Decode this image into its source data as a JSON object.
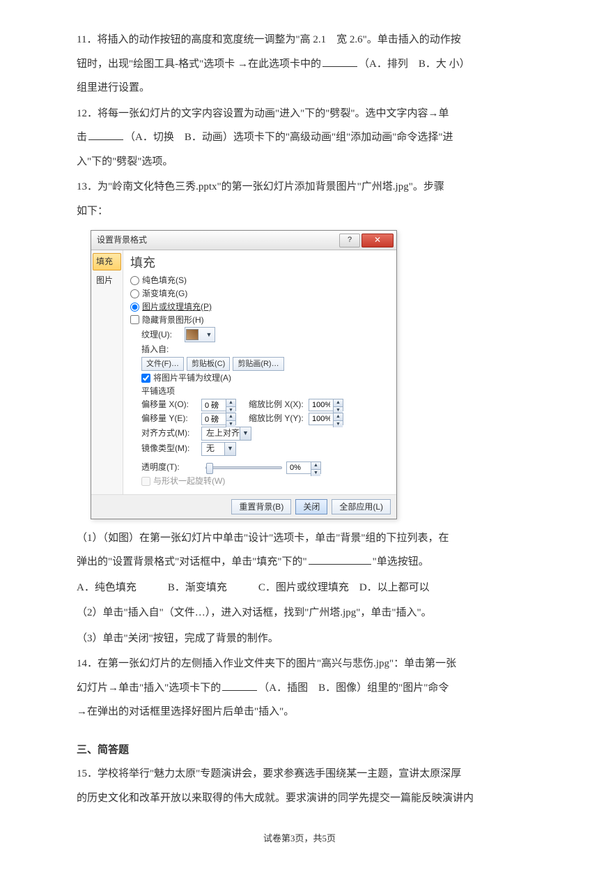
{
  "q11": {
    "text_a": "11．将插入的动作按钮的高度和宽度统一调整为\"高 2.1　宽 2.6\"。单击插入的动作按",
    "text_b": "钮时，出现\"绘图工具-格式\"选项卡 →在此选项卡中的",
    "opts": "（A．排列　B．大 小）",
    "text_c": "组里进行设置。"
  },
  "q12": {
    "text_a": "12．将每一张幻灯片的文字内容设置为动画\"进入\"下的\"劈裂\"。选中文字内容→单",
    "text_b": "击",
    "opts": "（A．切换　B．动画）选项卡下的\"高级动画\"组\"添加动画\"命令选择\"进",
    "text_c": "入\"下的\"劈裂\"选项。"
  },
  "q13": {
    "intro_a": "13．为\"岭南文化特色三秀.pptx\"的第一张幻灯片添加背景图片\"广州塔.jpg\"。步骤",
    "intro_b": "如下：",
    "step1_a": "（1）（如图）在第一张幻灯片中单击\"设计\"选项卡，单击\"背景\"组的下拉列表，在",
    "step1_b": "弹出的\"设置背景格式\"对话框中，单击\"填充\"下的\"",
    "step1_c": "\"单选按钮。",
    "opts": "A．纯色填充　　　B．渐变填充　　　C．图片或纹理填充　D．以上都可以",
    "step2": "（2）单击\"插入自\"（文件…），进入对话框，找到\"广州塔.jpg\"，单击\"插入\"。",
    "step3": "（3）单击\"关闭\"按钮，完成了背景的制作。"
  },
  "q14": {
    "text_a": "14．在第一张幻灯片的左侧插入作业文件夹下的图片\"高兴与悲伤.jpg\"：单击第一张",
    "text_b": "幻灯片→单击\"插入\"选项卡下的",
    "opts": "（A．插图　B．图像）组里的\"图片\"命令",
    "text_c": "→在弹出的对话框里选择好图片后单击\"插入\"。"
  },
  "section3": "三、简答题",
  "q15": {
    "text_a": "15．学校将举行\"魅力太原\"专题演讲会，要求参赛选手围绕某一主题，宣讲太原深厚",
    "text_b": "的历史文化和改革开放以来取得的伟大成就。要求演讲的同学先提交一篇能反映演讲内"
  },
  "dialog": {
    "title": "设置背景格式",
    "sidebar": {
      "item0": "填充",
      "item1": "图片"
    },
    "heading": "填充",
    "radio_solid": "纯色填充(S)",
    "radio_gradient": "渐变填充(G)",
    "radio_picture": "图片或纹理填充(P)",
    "chk_hidebg": "隐藏背景图形(H)",
    "lbl_texture": "纹理(U):",
    "lbl_insertfrom": "插入自:",
    "btn_file": "文件(F)…",
    "btn_clip1": "剪贴板(C)",
    "btn_clip2": "剪贴画(R)…",
    "chk_tile": "将图片平铺为纹理(A)",
    "subhead_tile": "平铺选项",
    "lbl_offx": "偏移量 X(O):",
    "lbl_offy": "偏移量 Y(E):",
    "val_offx": "0 磅",
    "val_offy": "0 磅",
    "lbl_scalex": "缩放比例 X(X):",
    "lbl_scaley": "缩放比例 Y(Y):",
    "val_scalex": "100%",
    "val_scaley": "100%",
    "lbl_align": "对齐方式(M):",
    "val_align": "左上对齐",
    "lbl_mirror": "镜像类型(M):",
    "val_mirror": "无",
    "lbl_trans": "透明度(T):",
    "val_trans": "0%",
    "chk_rotate": "与形状一起旋转(W)",
    "btn_reset": "重置背景(B)",
    "btn_close": "关闭",
    "btn_applyall": "全部应用(L)"
  },
  "footer": "试卷第3页，共5页"
}
